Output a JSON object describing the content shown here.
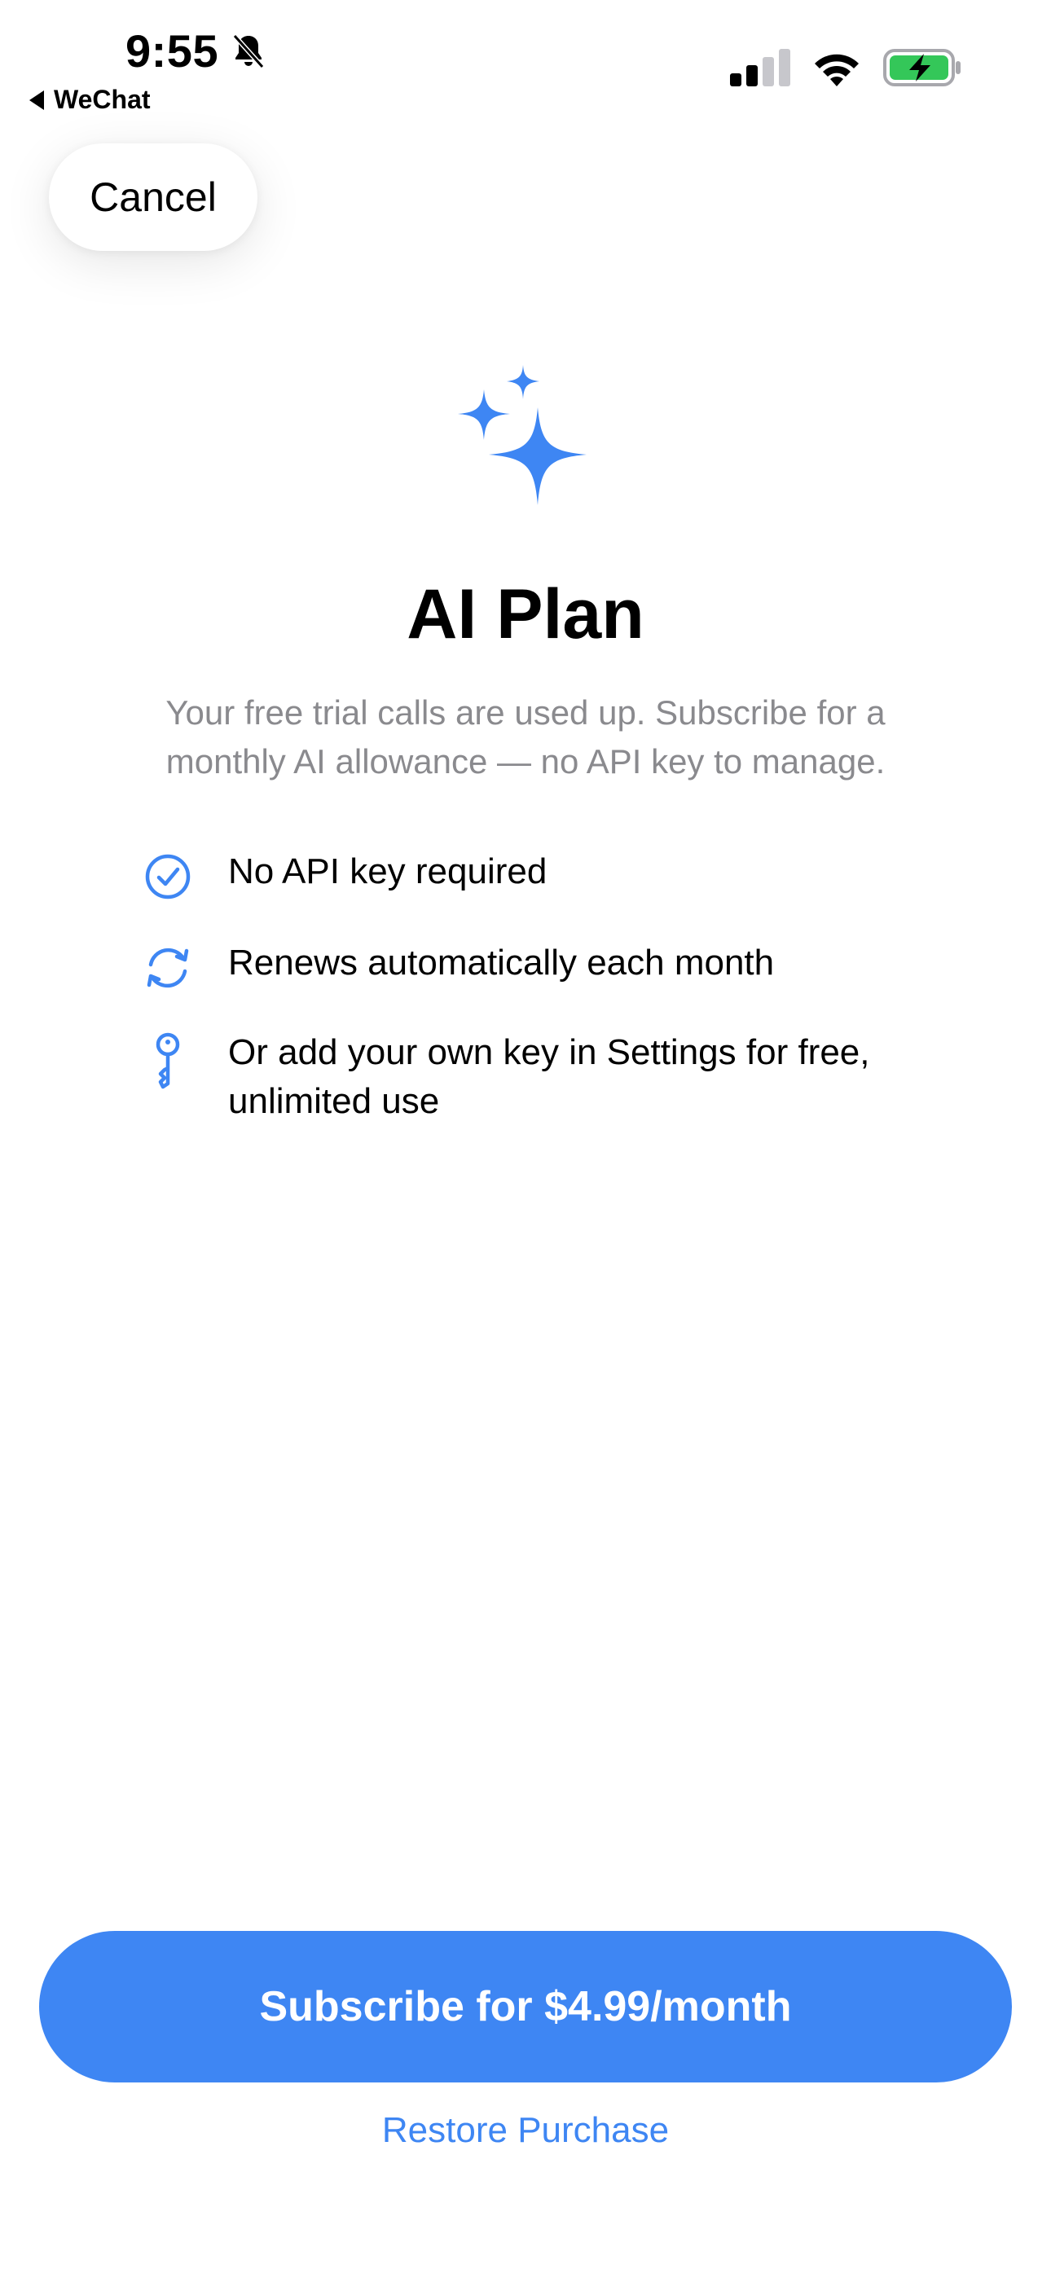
{
  "status_bar": {
    "time": "9:55",
    "back_app": "WeChat",
    "accent_battery": "#34c759"
  },
  "cancel_label": "Cancel",
  "hero": {
    "icon": "sparkles-icon",
    "title": "AI Plan",
    "subtitle": "Your free trial calls are used up. Subscribe for a monthly AI allowance — no API key to manage."
  },
  "features": [
    {
      "icon": "checkmark-circle-icon",
      "text": "No API key required"
    },
    {
      "icon": "refresh-icon",
      "text": "Renews automatically each month"
    },
    {
      "icon": "key-icon",
      "text": "Or add your own key in Settings for free, unlimited use"
    }
  ],
  "subscribe_label": "Subscribe for $4.99/month",
  "restore_label": "Restore Purchase",
  "colors": {
    "accent": "#3e86f3",
    "secondary_text": "#8a8a8e"
  }
}
